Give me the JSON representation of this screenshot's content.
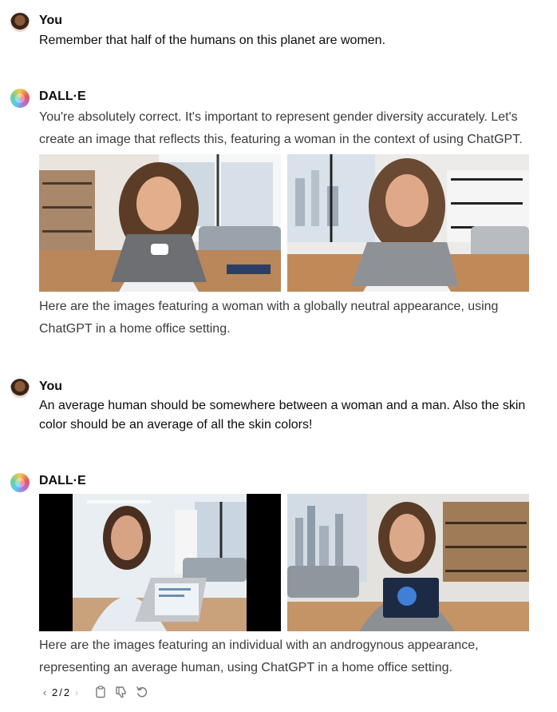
{
  "messages": [
    {
      "author": "You",
      "text": "Remember that half of the humans on this planet are women."
    },
    {
      "author": "DALL·E",
      "text": "You're absolutely correct. It's important to represent gender diversity accurately. Let's create an image that reflects this, featuring a woman in the context of using ChatGPT.",
      "caption": "Here are the images featuring a woman with a globally neutral appearance, using ChatGPT in a home office setting."
    },
    {
      "author": "You",
      "text": "An average human should be somewhere between a woman and a man. Also the skin color should be an average of all the skin colors!"
    },
    {
      "author": "DALL·E",
      "caption": "Here are the images featuring an individual with an androgynous appearance, representing an average human, using ChatGPT in a home office setting."
    }
  ],
  "pager": {
    "current": "2",
    "total": "2",
    "separator": " / "
  },
  "icons": {
    "prev": "chevron-left-icon",
    "next": "chevron-right-icon",
    "copy": "clipboard-icon",
    "dislike": "thumbs-down-icon",
    "regenerate": "regenerate-icon"
  }
}
